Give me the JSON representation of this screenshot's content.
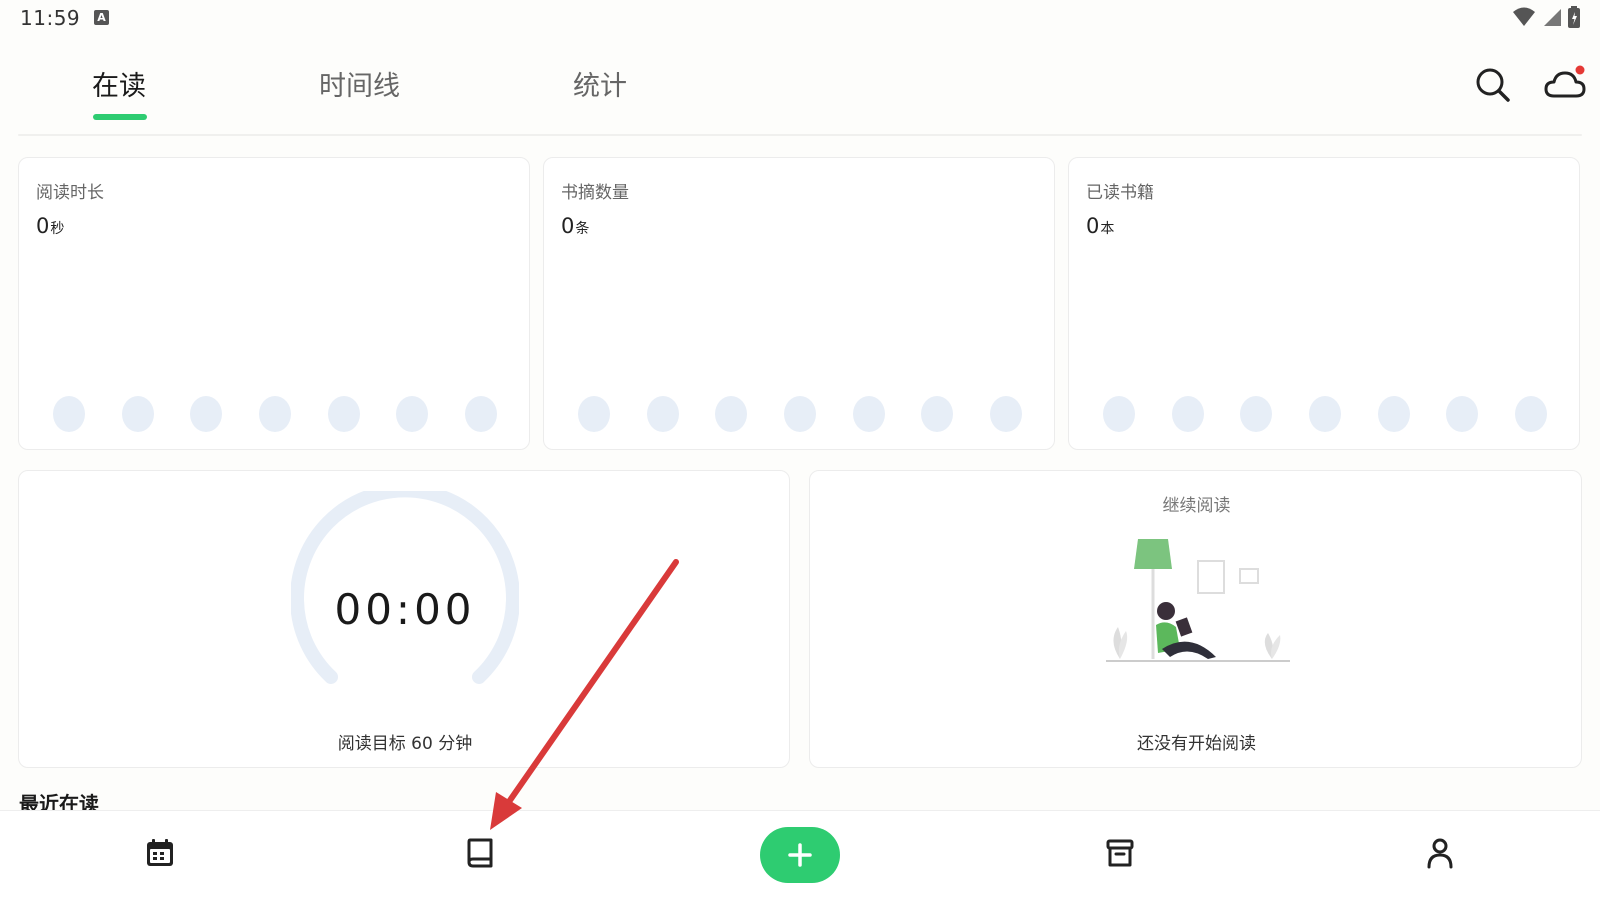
{
  "status_bar": {
    "time": "11:59",
    "notification_icon": "A"
  },
  "tabs": [
    {
      "label": "在读",
      "active": true
    },
    {
      "label": "时间线",
      "active": false
    },
    {
      "label": "统计",
      "active": false
    }
  ],
  "header_icons": [
    "search-icon",
    "cloud-sync-icon"
  ],
  "stats": [
    {
      "label": "阅读时长",
      "value": "0",
      "unit": "秒"
    },
    {
      "label": "书摘数量",
      "value": "0",
      "unit": "条"
    },
    {
      "label": "已读书籍",
      "value": "0",
      "unit": "本"
    }
  ],
  "timer": {
    "display": "00:00",
    "goal_text": "阅读目标 60 分钟"
  },
  "continue_reading": {
    "title": "继续阅读",
    "empty_text": "还没有开始阅读"
  },
  "recent": {
    "title": "最近在读"
  },
  "bottom_nav": [
    "calendar-icon",
    "book-icon",
    "add-icon",
    "archive-icon",
    "profile-icon"
  ],
  "colors": {
    "accent": "#2ecc71",
    "dot": "#e7eef7",
    "annotation_arrow": "#d93a3a",
    "notification_badge": "#e53935"
  }
}
